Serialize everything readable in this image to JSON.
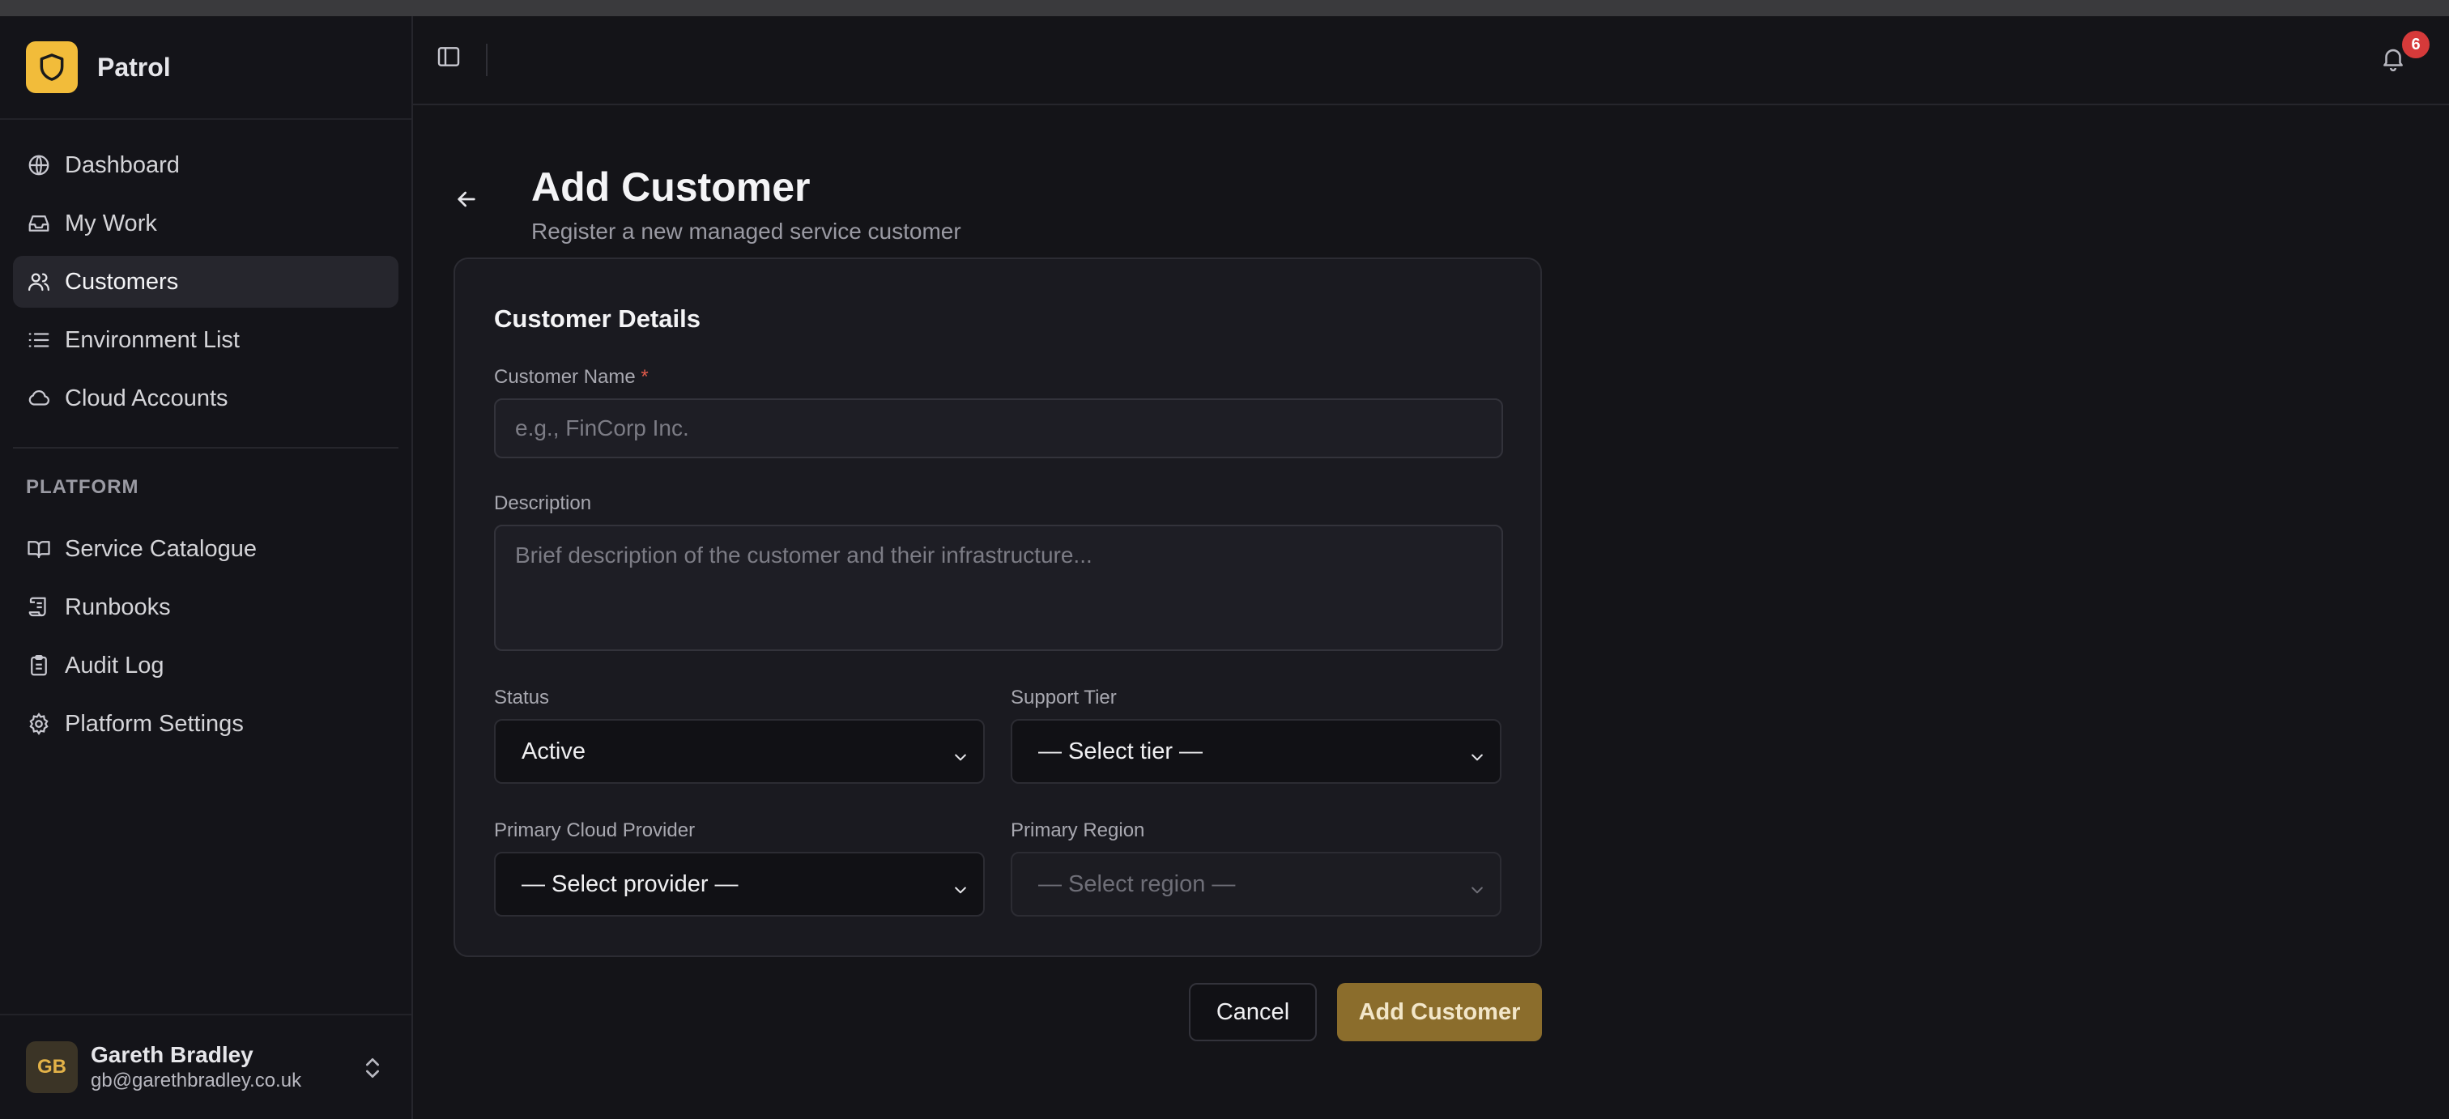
{
  "app": {
    "name": "Patrol"
  },
  "sidebar": {
    "items": [
      {
        "label": "Dashboard",
        "icon": "globe-icon"
      },
      {
        "label": "My Work",
        "icon": "inbox-icon"
      },
      {
        "label": "Customers",
        "icon": "users-icon",
        "active": true
      },
      {
        "label": "Environment List",
        "icon": "list-icon"
      },
      {
        "label": "Cloud Accounts",
        "icon": "cloud-icon"
      }
    ],
    "platform_heading": "PLATFORM",
    "platform_items": [
      {
        "label": "Service Catalogue",
        "icon": "book-icon"
      },
      {
        "label": "Runbooks",
        "icon": "scroll-icon"
      },
      {
        "label": "Audit Log",
        "icon": "clipboard-icon"
      },
      {
        "label": "Platform Settings",
        "icon": "gear-icon"
      }
    ],
    "user": {
      "initials": "GB",
      "name": "Gareth Bradley",
      "email": "gb@garethbradley.co.uk"
    }
  },
  "topbar": {
    "notification_count": "6"
  },
  "page": {
    "title": "Add Customer",
    "subtitle": "Register a new managed service customer"
  },
  "form": {
    "section_title": "Customer Details",
    "customer_name": {
      "label": "Customer Name",
      "required_mark": "*",
      "placeholder": "e.g., FinCorp Inc.",
      "value": ""
    },
    "description": {
      "label": "Description",
      "placeholder": "Brief description of the customer and their infrastructure...",
      "value": ""
    },
    "status": {
      "label": "Status",
      "value": "Active"
    },
    "support_tier": {
      "label": "Support Tier",
      "value": "— Select tier —"
    },
    "cloud_provider": {
      "label": "Primary Cloud Provider",
      "value": "— Select provider —"
    },
    "region": {
      "label": "Primary Region",
      "value": "— Select region —",
      "disabled": true
    }
  },
  "actions": {
    "cancel_label": "Cancel",
    "submit_label": "Add Customer"
  },
  "colors": {
    "accent": "#f2bc3a",
    "primary_button": "#8b6d2c",
    "badge": "#d63a3a",
    "background": "#141418"
  }
}
